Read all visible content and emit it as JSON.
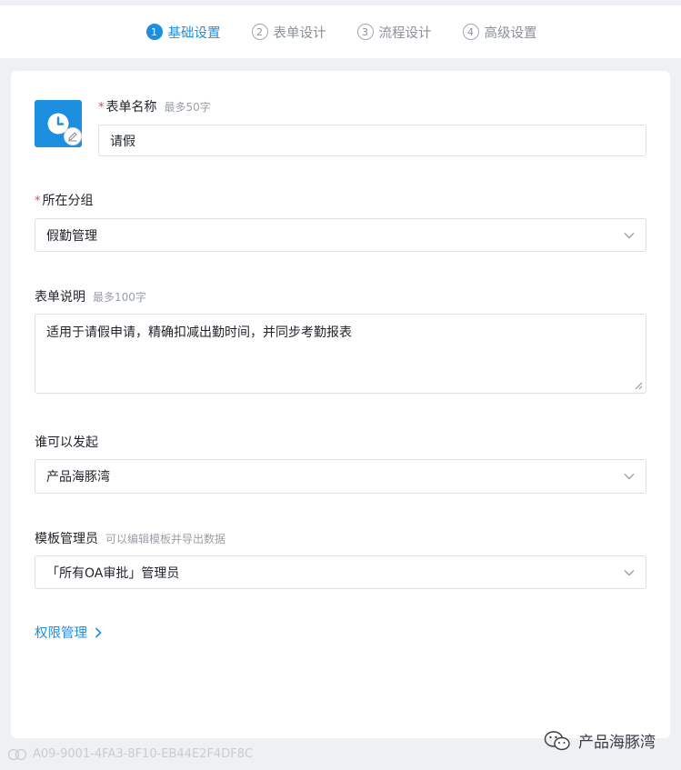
{
  "steps": [
    {
      "num": "1",
      "label": "基础设置"
    },
    {
      "num": "2",
      "label": "表单设计"
    },
    {
      "num": "3",
      "label": "流程设计"
    },
    {
      "num": "4",
      "label": "高级设置"
    }
  ],
  "form_name": {
    "required_mark": "*",
    "label": "表单名称",
    "hint": "最多50字",
    "value": "请假"
  },
  "group": {
    "required_mark": "*",
    "label": "所在分组",
    "value": "假勤管理"
  },
  "description": {
    "label": "表单说明",
    "hint": "最多100字",
    "value": "适用于请假申请，精确扣减出勤时间，并同步考勤报表"
  },
  "initiator": {
    "label": "谁可以发起",
    "value": "产品海豚湾"
  },
  "template_admin": {
    "label": "模板管理员",
    "hint": "可以编辑模板并导出数据",
    "value": "「所有OA审批」管理员"
  },
  "permission_link": {
    "label": "权限管理"
  },
  "watermark": {
    "left_text": "A09-9001-4FA3-8F10-EB44E2F4DF8C",
    "right_text": "产品海豚湾"
  },
  "colors": {
    "accent": "#1d8fe0",
    "required": "#e54545"
  },
  "icons": {
    "avatar": "clock-icon",
    "edit": "pencil-icon",
    "select": "chevron-down-icon",
    "link": "chevron-right-icon"
  }
}
